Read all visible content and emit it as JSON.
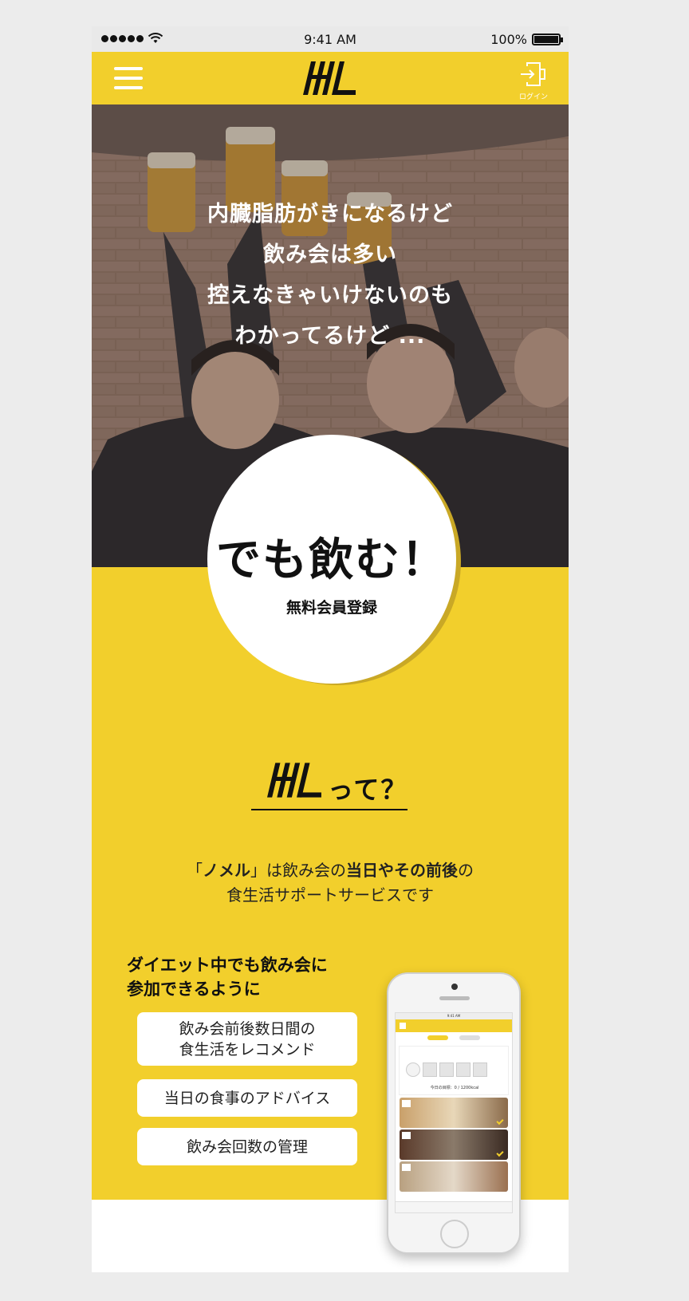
{
  "status_bar": {
    "time": "9:41 AM",
    "battery": "100%"
  },
  "header": {
    "login_label": "ログイン"
  },
  "hero": {
    "lines": [
      "内臓脂肪がきになるけど",
      "飲み会は多い",
      "控えなきゃいけないのも",
      "わかってるけど ..."
    ]
  },
  "cta": {
    "main": "でも飲む！",
    "sub": "無料会員登録"
  },
  "about": {
    "title_suffix": "って？",
    "desc_open_quote": "「",
    "desc_name": "ノメル",
    "desc_close_quote": "」",
    "desc_mid": "は飲み会の",
    "desc_strong": "当日やその前後",
    "desc_end": "の",
    "desc_line2": "食生活サポートサービスです"
  },
  "features": {
    "title_line1": "ダイエット中でも飲み会に",
    "title_line2": "参加できるように",
    "items": [
      {
        "line1": "飲み会前後数日間の",
        "line2": "食生活をレコメンド"
      },
      {
        "line1": "当日の食事のアドバイス",
        "line2": ""
      },
      {
        "line1": "飲み会回数の管理",
        "line2": ""
      }
    ]
  },
  "mockup": {
    "status_time": "9:41 AM",
    "target_text": "今日の目標：0 / 1200kcal"
  },
  "colors": {
    "accent": "#f2cf2c",
    "text": "#111111",
    "page_bg": "#ececec"
  }
}
